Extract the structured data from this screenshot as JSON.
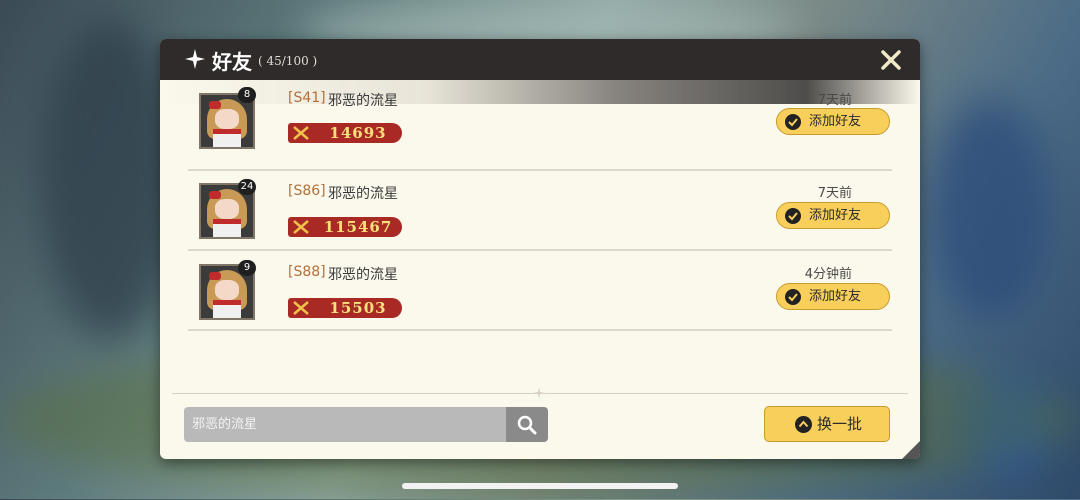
{
  "header": {
    "title": "好友",
    "count": "( 45/100 )"
  },
  "friends": [
    {
      "level": "8",
      "server": "[S41]",
      "name": "邪恶的流星",
      "power": "14693",
      "time": "7天前",
      "add_label": "添加好友"
    },
    {
      "level": "24",
      "server": "[S86]",
      "name": "邪恶的流星",
      "power": "115467",
      "time": "7天前",
      "add_label": "添加好友"
    },
    {
      "level": "9",
      "server": "[S88]",
      "name": "邪恶的流星",
      "power": "15503",
      "time": "4分钟前",
      "add_label": "添加好友"
    }
  ],
  "search": {
    "placeholder": "邪恶的流星"
  },
  "refresh": {
    "label": "换一批"
  },
  "colors": {
    "accent": "#f8cf5b",
    "header": "#2f2b2a",
    "power_bg": "#a92a24",
    "server_text": "#b1703a"
  },
  "icons": [
    "star-icon",
    "close-icon",
    "sword-icon",
    "check-icon",
    "search-icon",
    "refresh-icon",
    "sparkle-icon"
  ]
}
